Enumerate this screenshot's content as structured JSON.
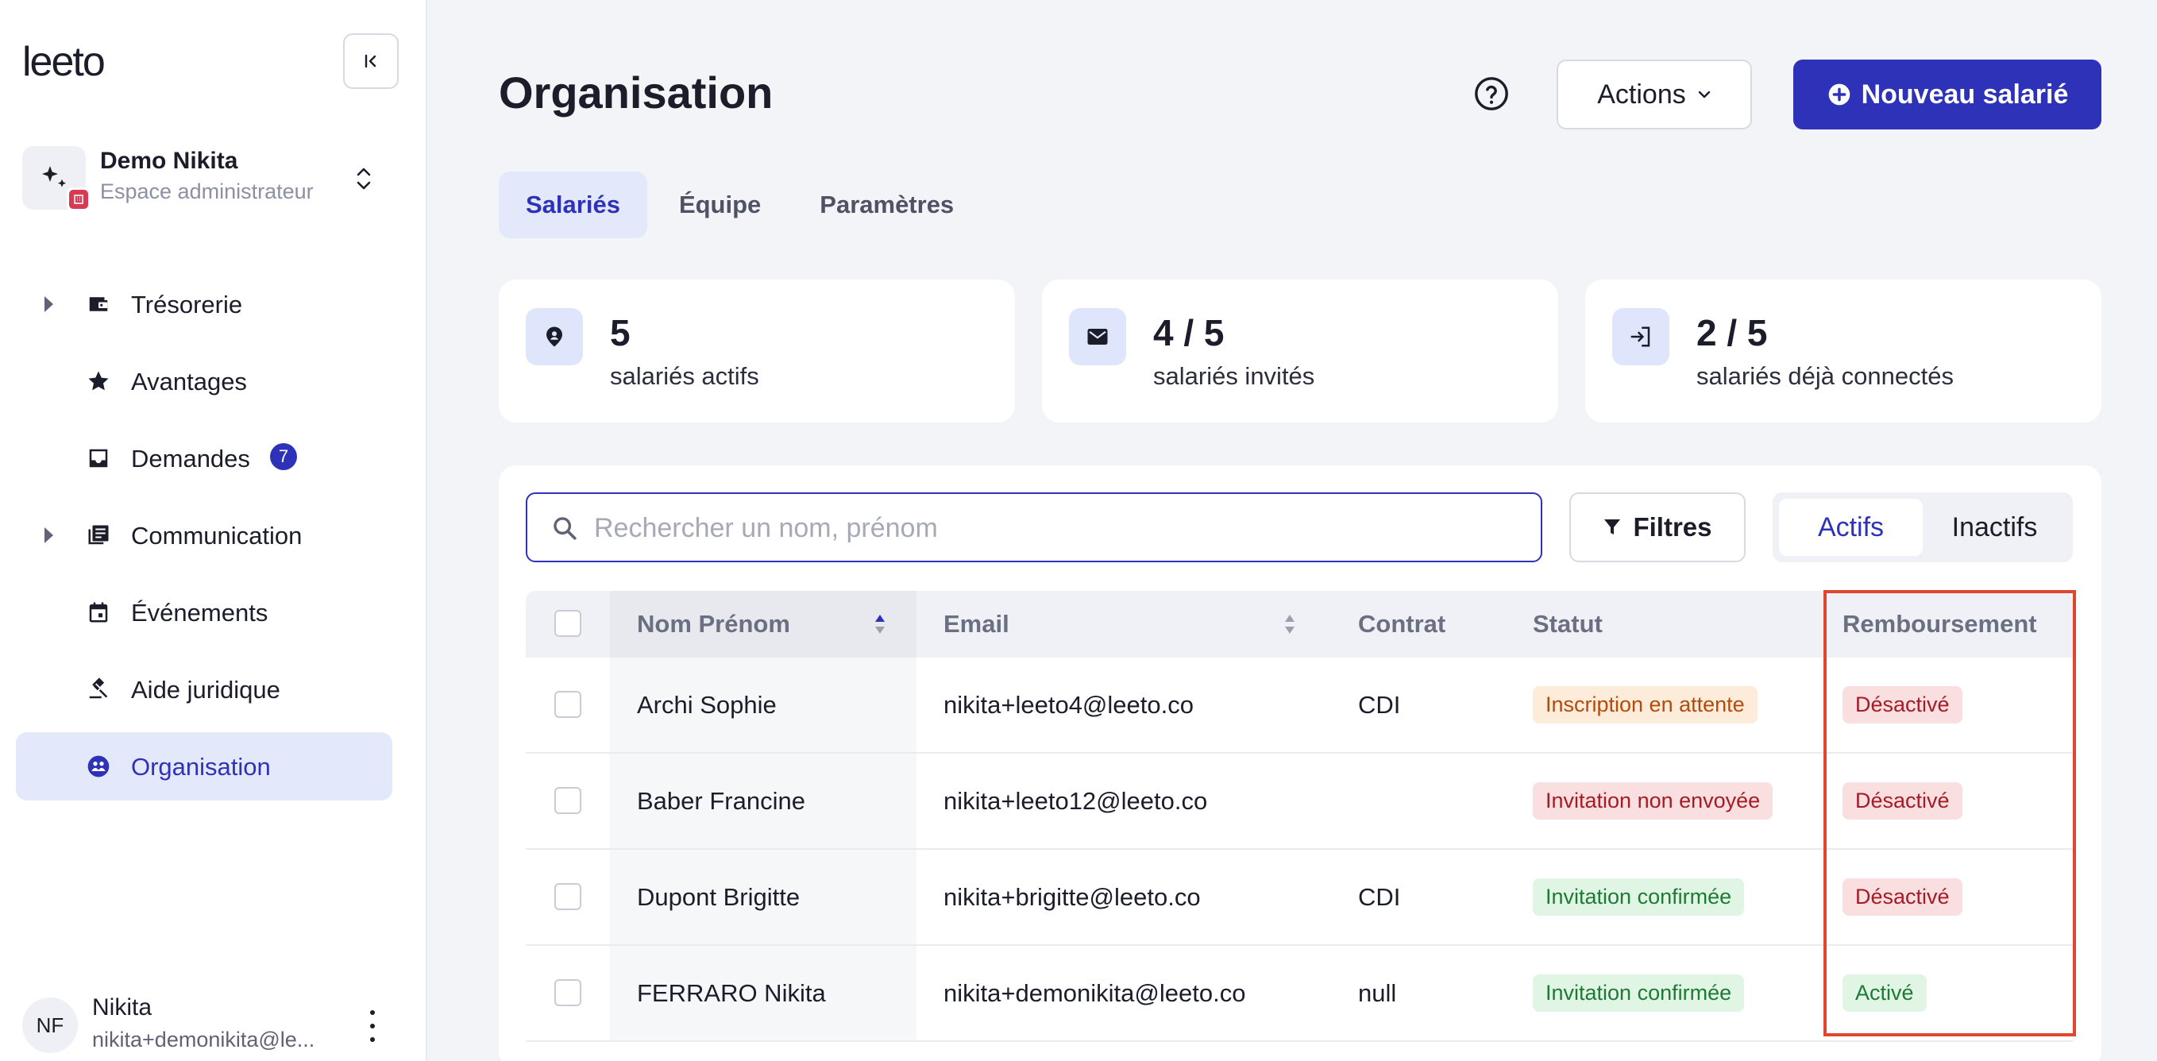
{
  "sidebar": {
    "logo": "leeto",
    "workspace": {
      "name": "Demo Nikita",
      "subtitle": "Espace administrateur"
    },
    "items": [
      {
        "label": "Trésorerie",
        "icon": "wallet-icon",
        "expandable": true
      },
      {
        "label": "Avantages",
        "icon": "star-icon",
        "expandable": false
      },
      {
        "label": "Demandes",
        "icon": "inbox-icon",
        "expandable": false,
        "count": "7"
      },
      {
        "label": "Communication",
        "icon": "newspaper-icon",
        "expandable": true
      },
      {
        "label": "Événements",
        "icon": "calendar-icon",
        "expandable": false
      },
      {
        "label": "Aide juridique",
        "icon": "gavel-icon",
        "expandable": false
      },
      {
        "label": "Organisation",
        "icon": "groups-icon",
        "expandable": false,
        "active": true
      }
    ],
    "user": {
      "initials": "NF",
      "name": "Nikita",
      "email": "nikita+demonikita@le..."
    }
  },
  "header": {
    "title": "Organisation",
    "actions_label": "Actions",
    "new_label": "Nouveau salarié"
  },
  "tabs": [
    {
      "label": "Salariés",
      "active": true
    },
    {
      "label": "Équipe"
    },
    {
      "label": "Paramètres"
    }
  ],
  "stats": [
    {
      "value": "5",
      "label": "salariés actifs",
      "icon": "person-pin-icon"
    },
    {
      "value": "4 / 5",
      "label": "salariés invités",
      "icon": "mail-icon"
    },
    {
      "value": "2 / 5",
      "label": "salariés déjà connectés",
      "icon": "login-icon"
    }
  ],
  "search": {
    "placeholder": "Rechercher un nom, prénom",
    "value": ""
  },
  "filters_label": "Filtres",
  "segment": {
    "active": "Actifs",
    "inactive": "Inactifs"
  },
  "table": {
    "headers": {
      "name": "Nom Prénom",
      "email": "Email",
      "contract": "Contrat",
      "status": "Statut",
      "reimbursement": "Remboursement"
    },
    "rows": [
      {
        "name": "Archi Sophie",
        "email": "nikita+leeto4@leeto.co",
        "contract": "CDI",
        "status": "Inscription en attente",
        "status_color": "orange",
        "reimbursement": "Désactivé",
        "reimbursement_color": "red"
      },
      {
        "name": "Baber Francine",
        "email": "nikita+leeto12@leeto.co",
        "contract": "",
        "status": "Invitation non envoyée",
        "status_color": "red",
        "reimbursement": "Désactivé",
        "reimbursement_color": "red"
      },
      {
        "name": "Dupont Brigitte",
        "email": "nikita+brigitte@leeto.co",
        "contract": "CDI",
        "status": "Invitation confirmée",
        "status_color": "green",
        "reimbursement": "Désactivé",
        "reimbursement_color": "red"
      },
      {
        "name": "FERRARO Nikita",
        "email": "nikita+demonikita@leeto.co",
        "contract": "null",
        "status": "Invitation confirmée",
        "status_color": "green",
        "reimbursement": "Activé",
        "reimbursement_color": "green"
      }
    ]
  },
  "colors": {
    "brand": "#2e32b8",
    "highlight": "#e0452e"
  }
}
